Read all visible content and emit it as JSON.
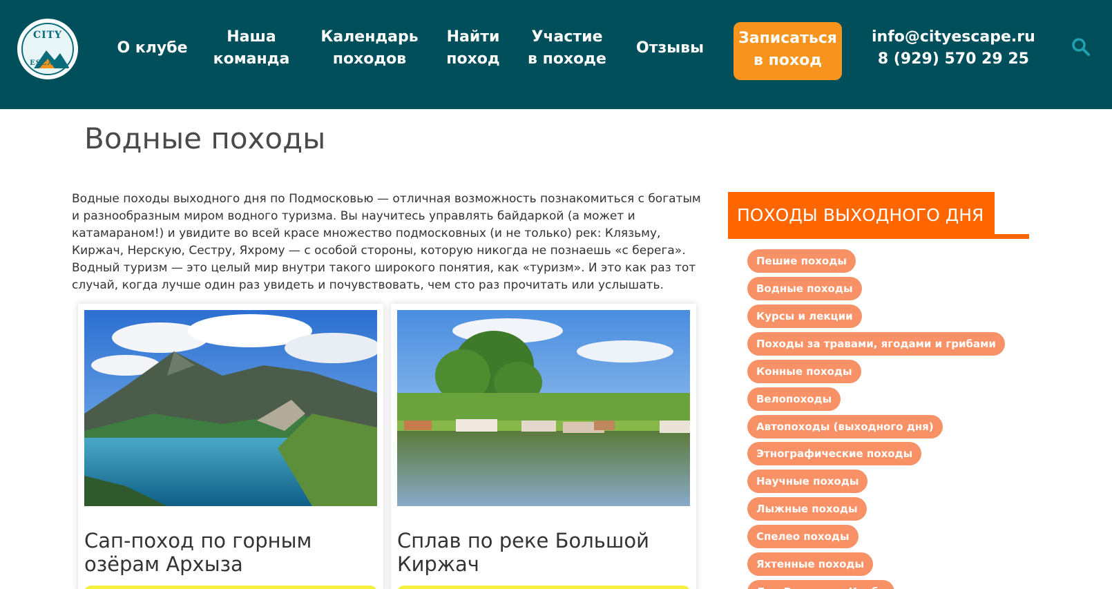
{
  "header": {
    "logo": {
      "top": "CITY",
      "bottom": "ESCAPE"
    },
    "nav": [
      {
        "label": "О клубе"
      },
      {
        "label": "Наша команда"
      },
      {
        "label": "Календарь походов"
      },
      {
        "label": "Найти поход"
      },
      {
        "label": "Участие в походе"
      },
      {
        "label": "Отзывы"
      }
    ],
    "cta": "Записаться в поход",
    "email": "info@cityescape.ru",
    "phone": "8 (929) 570 29 25",
    "search_icon": "search-icon",
    "colors": {
      "bg": "#004f5b",
      "cta": "#f7941d"
    }
  },
  "page": {
    "title": "Водные походы",
    "intro": "Водные походы выходного дня по Подмосковью — отличная возможность познакомиться с богатым и разнообразным миром водного туризма. Вы научитесь управлять байдаркой (а может и катамараном!) и увидите во всей красе множество подмосковных (и не только) рек: Клязьму, Киржач, Нерскую, Сестру, Яхрому — с особой стороны, которую никогда не познаешь «с берега». Водный туризм — это целый мир внутри такого широкого понятия, как «туризм». И это как раз тот случай, когда лучше один раз увидеть и почувствовать, чем сто раз прочитать или услышать."
  },
  "cards": [
    {
      "title": "Сап-поход по горным озёрам Архыза"
    },
    {
      "title": "Сплав по реке Большой Киржач"
    }
  ],
  "sidebar": {
    "title": "ПОХОДЫ ВЫХОДНОГО ДНЯ",
    "accent": "#ff6600",
    "tag_color": "#f99166",
    "tags": [
      "Пешие походы",
      "Водные походы",
      "Курсы и лекции",
      "Походы за травами, ягодами и грибами",
      "Конные походы",
      "Велопоходы",
      "Автопоходы (выходного дня)",
      "Этнографические походы",
      "Научные походы",
      "Лыжные походы",
      "Спелео походы",
      "Яхтенные походы",
      "Дни Рождения Клуба"
    ]
  }
}
